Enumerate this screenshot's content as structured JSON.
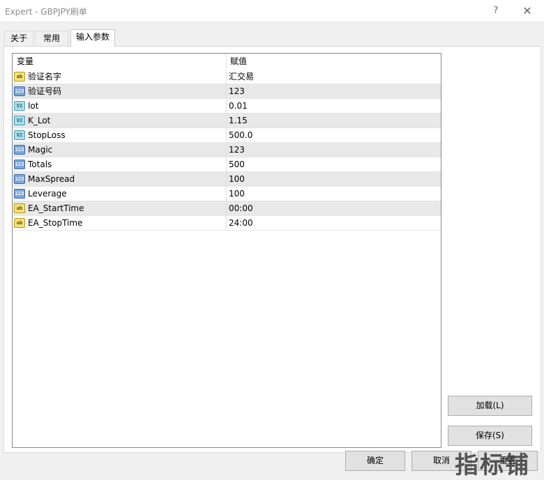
{
  "window": {
    "title": "Expert - GBPJPY刷单",
    "help_label": "?",
    "close_label": "✕"
  },
  "tabs": [
    {
      "label": "关于"
    },
    {
      "label": "常用"
    },
    {
      "label": "输入参数",
      "active": true
    }
  ],
  "grid": {
    "columns": [
      "变量",
      "赋值"
    ],
    "rows": [
      {
        "icon": "ab",
        "icon_name": "string-type-icon",
        "name": "验证名字",
        "value": "汇交易"
      },
      {
        "icon": "123",
        "icon_name": "integer-type-icon",
        "name": "验证号码",
        "value": "123"
      },
      {
        "icon": "V2",
        "icon_name": "double-type-icon",
        "name": "lot",
        "value": "0.01"
      },
      {
        "icon": "V2",
        "icon_name": "double-type-icon",
        "name": "K_Lot",
        "value": "1.15"
      },
      {
        "icon": "V2",
        "icon_name": "double-type-icon",
        "name": "StopLoss",
        "value": "500.0"
      },
      {
        "icon": "123",
        "icon_name": "integer-type-icon",
        "name": "Magic",
        "value": "123"
      },
      {
        "icon": "123",
        "icon_name": "integer-type-icon",
        "name": "Totals",
        "value": "500"
      },
      {
        "icon": "123",
        "icon_name": "integer-type-icon",
        "name": "MaxSpread",
        "value": "100"
      },
      {
        "icon": "123",
        "icon_name": "integer-type-icon",
        "name": "Leverage",
        "value": "100"
      },
      {
        "icon": "ab",
        "icon_name": "string-type-icon",
        "name": "EA_StartTime",
        "value": "00:00"
      },
      {
        "icon": "ab",
        "icon_name": "string-type-icon",
        "name": "EA_StopTime",
        "value": "24:00"
      }
    ]
  },
  "buttons": {
    "load": "加载(L)",
    "save": "保存(S)",
    "ok": "确定",
    "cancel": "取消",
    "reset": "重置"
  },
  "watermark": "指标铺"
}
